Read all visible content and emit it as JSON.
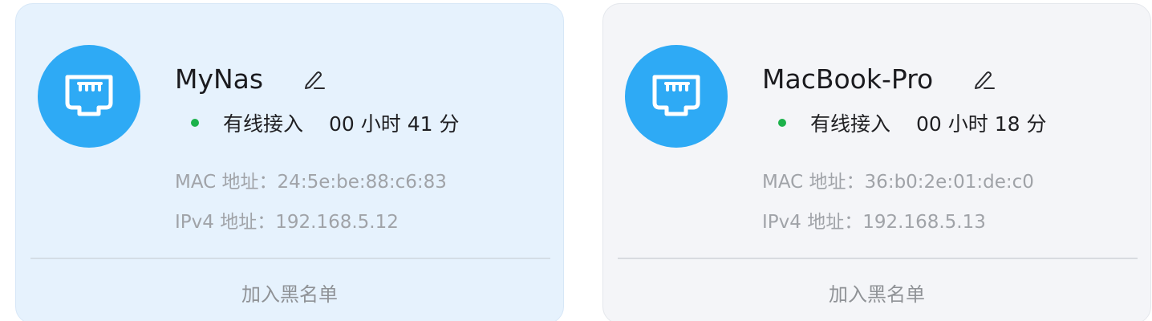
{
  "devices": [
    {
      "name": "MyNas",
      "status_dot_color": "#1cb24b",
      "connection": "有线接入",
      "duration": "00 小时 41 分",
      "mac_label": "MAC 地址：",
      "mac": "24:5e:be:88:c6:83",
      "ipv4_label": "IPv4 地址：",
      "ipv4": "192.168.5.12",
      "action": "加入黑名单",
      "icon": "ethernet-port-icon"
    },
    {
      "name": "MacBook-Pro",
      "status_dot_color": "#1cb24b",
      "connection": "有线接入",
      "duration": "00 小时 18 分",
      "mac_label": "MAC 地址：",
      "mac": "36:b0:2e:01:de:c0",
      "ipv4_label": "IPv4 地址：",
      "ipv4": "192.168.5.13",
      "action": "加入黑名单",
      "icon": "ethernet-port-icon"
    }
  ],
  "colors": {
    "accent": "#2eaaf5",
    "card_selected_bg": "#e6f2fd",
    "card_bg": "#f4f5f8"
  }
}
